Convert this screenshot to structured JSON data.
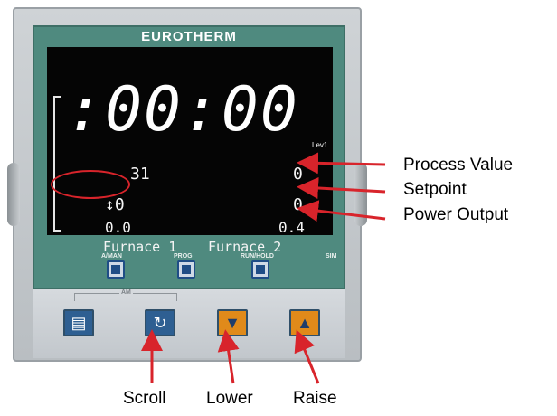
{
  "controller": {
    "brand": "EUROTHERM",
    "screen": {
      "time": ":00:00",
      "level": "Lev1",
      "process_value_left": "31",
      "process_value_right": "0",
      "setpoint_left": "↕0",
      "setpoint_right": "0",
      "output_left": "0.0",
      "output_right": "0.4",
      "zone_left": "Furnace 1",
      "zone_right": "Furnace 2"
    },
    "function_buttons": [
      {
        "label": "A/MAN"
      },
      {
        "label": "PROG"
      },
      {
        "label": "RUN/HOLD"
      }
    ],
    "small_label": "SIM",
    "am_label": "AM"
  },
  "annotations": {
    "process_value": "Process Value",
    "setpoint": "Setpoint",
    "power_output": "Power Output",
    "scroll": "Scroll",
    "lower": "Lower",
    "raise": "Raise"
  },
  "colors": {
    "faceplate": "#4f8a7f",
    "screen": "#050505",
    "arrow": "#d8242b",
    "blue_key": "#2e5f92",
    "orange_key": "#e08a1a"
  },
  "icons": {
    "page_key": "page-icon",
    "scroll_key": "scroll-icon",
    "lower_key": "triangle-down-icon",
    "raise_key": "triangle-up-icon"
  }
}
